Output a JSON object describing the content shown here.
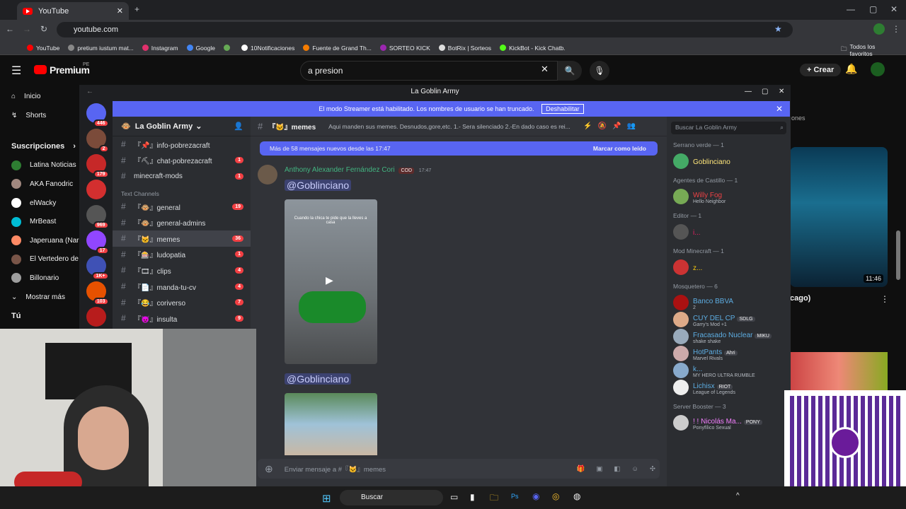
{
  "browser": {
    "tab_title": "YouTube",
    "url": "youtube.com",
    "bookmarks": [
      "YouTube",
      "pretium iustum mat...",
      "Instagram",
      "Google",
      "",
      "10Notificaciones",
      "Fuente de Grand Th...",
      "SORTEO KICK",
      "BotRix | Sorteos",
      "KickBot - Kick Chatb...",
      "|"
    ],
    "all_bookmarks": "Todos los favoritos"
  },
  "youtube": {
    "logo": "Premium",
    "region": "PE",
    "search": "a presion",
    "create": "Crear",
    "sidebar": [
      {
        "label": "Inicio"
      },
      {
        "label": "Shorts"
      }
    ],
    "subs_header": "Suscripciones",
    "subs": [
      "Latina Noticias",
      "AKA Fanodric",
      "elWacky",
      "MrBeast",
      "Japeruana (Nar",
      "El Vertedero de",
      "Billonario",
      "Mostrar más"
    ],
    "tu": "Tú",
    "video_time": "11:46",
    "video_title_frag": "cago)",
    "ones": "ones"
  },
  "discord": {
    "title": "La Goblin Army",
    "banner_text": "El modo Streamer está habilitado. Los nombres de usuario se han truncado.",
    "banner_btn": "Deshabilitar",
    "server_name": "La Goblin Army",
    "server_badges": [
      "446",
      "2",
      "179",
      "",
      "969",
      "17",
      "1K+",
      "103",
      "",
      "",
      ""
    ],
    "channels_top": [
      {
        "name": "『📌』info-pobrezacraft"
      },
      {
        "name": "『⛏』chat-pobrezacraft",
        "count": "1"
      },
      {
        "name": "minecraft-mods",
        "count": "1"
      }
    ],
    "category": "Text Channels",
    "channels": [
      {
        "name": "『🐵』general",
        "count": "19"
      },
      {
        "name": "『🐵』general-admins",
        "count": ""
      },
      {
        "name": "『🐱』memes",
        "count": "36"
      },
      {
        "name": "『🎰』ludopatia",
        "count": "1"
      },
      {
        "name": "『🎞』clips",
        "count": "4"
      },
      {
        "name": "『📄』manda-tu-cv",
        "count": "4"
      },
      {
        "name": "『😂』coriverso",
        "count": "7"
      },
      {
        "name": "『😈』insulta",
        "count": "9"
      }
    ],
    "channel_name": "『🐱』memes",
    "channel_topic": "Aqui manden sus memes. Desnudos,gore,etc. 1.- Sera silenciado 2.-En dado caso es rei...",
    "search_placeholder": "Buscar La Goblin Army",
    "new_msgs": "Más de 58 mensajes nuevos desde las 17:47",
    "mark_read": "Marcar como leído",
    "message": {
      "author": "Anthony Alexander Fernández Cori",
      "tag": "COD",
      "time": "17:47",
      "mention": "@Goblinciano",
      "caption": "Cuando la chica te pide que la lleves a casa"
    },
    "input_placeholder": "Enviar mensaje a #『🐱』memes",
    "member_groups": [
      {
        "name": "Serrano verde — 1",
        "members": [
          {
            "name": "Goblinciano",
            "sub": "",
            "color": "#ffe67a"
          }
        ]
      },
      {
        "name": "Agentes de Castillo — 1",
        "members": [
          {
            "name": "Willy Fog",
            "sub": "Hello Neighbor",
            "color": "#ed4245"
          }
        ]
      },
      {
        "name": "Editor — 1",
        "members": [
          {
            "name": "i...",
            "sub": "",
            "color": "#e91e63"
          }
        ]
      },
      {
        "name": "Mod Minecraft — 1",
        "members": [
          {
            "name": "z...",
            "sub": "",
            "color": "#f1c40f"
          }
        ]
      },
      {
        "name": "Mosquetero — 6",
        "members": [
          {
            "name": "Banco BBVA",
            "sub": "2",
            "color": "#5dade2"
          },
          {
            "name": "CUY DEL CP",
            "sub": "Garry's Mod +1",
            "color": "#5dade2",
            "tag": "SDLG"
          },
          {
            "name": "Fracasado Nuclear",
            "sub": "shake shake",
            "color": "#5dade2",
            "tag": "MIKU"
          },
          {
            "name": "HotPants",
            "sub": "Marvel Rivals",
            "color": "#5dade2",
            "tag": "Ahri"
          },
          {
            "name": "k...",
            "sub": "MY HERO ULTRA RUMBLE",
            "color": "#5dade2"
          },
          {
            "name": "Lichisx",
            "sub": "League of Legends",
            "color": "#5dade2",
            "tag": "RIOT"
          }
        ]
      },
      {
        "name": "Server Booster — 3",
        "members": [
          {
            "name": "! ! Nicolás Ma...",
            "sub": "Ponyfílico Sexual",
            "color": "#f47fff",
            "tag": "PONY"
          }
        ]
      }
    ]
  },
  "taskbar": {
    "search": "Buscar"
  }
}
